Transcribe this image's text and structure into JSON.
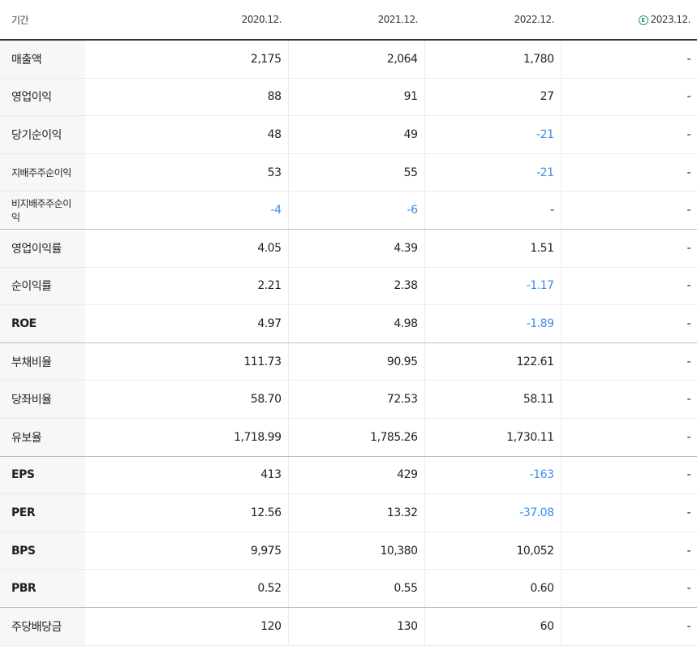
{
  "header": {
    "period_label": "기간",
    "columns": [
      "2020.12.",
      "2021.12.",
      "2022.12.",
      "2023.12."
    ],
    "estimate_mark": "E"
  },
  "rows": [
    {
      "label": "매출액",
      "values": [
        "2,175",
        "2,064",
        "1,780",
        "-"
      ]
    },
    {
      "label": "영업이익",
      "values": [
        "88",
        "91",
        "27",
        "-"
      ]
    },
    {
      "label": "당기순이익",
      "values": [
        "48",
        "49",
        "-21",
        "-"
      ]
    },
    {
      "label": "지배주주순이익",
      "values": [
        "53",
        "55",
        "-21",
        "-"
      ]
    },
    {
      "label": "비지배주주순이익",
      "values": [
        "-4",
        "-6",
        "-",
        "-"
      ]
    },
    {
      "label": "영업이익률",
      "values": [
        "4.05",
        "4.39",
        "1.51",
        "-"
      ]
    },
    {
      "label": "순이익률",
      "values": [
        "2.21",
        "2.38",
        "-1.17",
        "-"
      ]
    },
    {
      "label": "ROE",
      "values": [
        "4.97",
        "4.98",
        "-1.89",
        "-"
      ]
    },
    {
      "label": "부채비율",
      "values": [
        "111.73",
        "90.95",
        "122.61",
        "-"
      ]
    },
    {
      "label": "당좌비율",
      "values": [
        "58.70",
        "72.53",
        "58.11",
        "-"
      ]
    },
    {
      "label": "유보율",
      "values": [
        "1,718.99",
        "1,785.26",
        "1,730.11",
        "-"
      ]
    },
    {
      "label": "EPS",
      "values": [
        "413",
        "429",
        "-163",
        "-"
      ]
    },
    {
      "label": "PER",
      "values": [
        "12.56",
        "13.32",
        "-37.08",
        "-"
      ]
    },
    {
      "label": "BPS",
      "values": [
        "9,975",
        "10,380",
        "10,052",
        "-"
      ]
    },
    {
      "label": "PBR",
      "values": [
        "0.52",
        "0.55",
        "0.60",
        "-"
      ]
    },
    {
      "label": "주당배당금",
      "values": [
        "120",
        "130",
        "60",
        "-"
      ]
    }
  ],
  "colors": {
    "negative": "#3a8ee6",
    "estimate_icon": "#22a06b"
  }
}
